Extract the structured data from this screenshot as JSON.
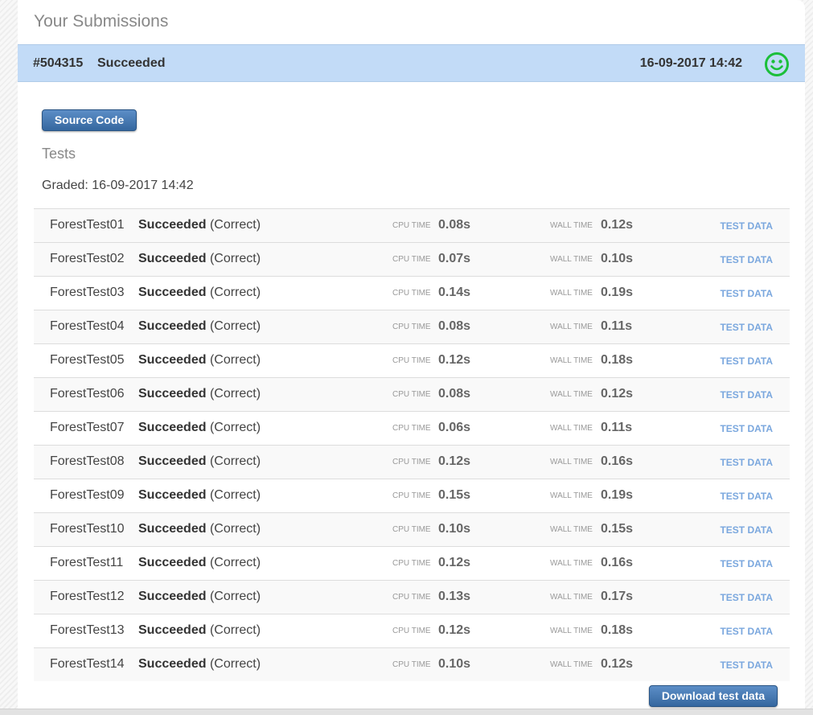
{
  "panel": {
    "title": "Your Submissions"
  },
  "submission": {
    "id": "#504315",
    "status": "Succeeded",
    "date": "16-09-2017 14:42",
    "status_icon": "smiley-icon",
    "status_color": "#1bbf3a",
    "header_bg": "#c2dbf7"
  },
  "details": {
    "source_button_label": "Source Code",
    "tests_heading": "Tests",
    "graded_text": "Graded: 16-09-2017 14:42",
    "cpu_label": "CPU TIME",
    "wall_label": "WALL TIME",
    "test_data_label": "TEST DATA",
    "download_button_label": "Download test data"
  },
  "tests": [
    {
      "name": "ForestTest01",
      "status": "Succeeded",
      "verdict": "(Correct)",
      "cpu": "0.08s",
      "wall": "0.12s"
    },
    {
      "name": "ForestTest02",
      "status": "Succeeded",
      "verdict": "(Correct)",
      "cpu": "0.07s",
      "wall": "0.10s"
    },
    {
      "name": "ForestTest03",
      "status": "Succeeded",
      "verdict": "(Correct)",
      "cpu": "0.14s",
      "wall": "0.19s"
    },
    {
      "name": "ForestTest04",
      "status": "Succeeded",
      "verdict": "(Correct)",
      "cpu": "0.08s",
      "wall": "0.11s"
    },
    {
      "name": "ForestTest05",
      "status": "Succeeded",
      "verdict": "(Correct)",
      "cpu": "0.12s",
      "wall": "0.18s"
    },
    {
      "name": "ForestTest06",
      "status": "Succeeded",
      "verdict": "(Correct)",
      "cpu": "0.08s",
      "wall": "0.12s"
    },
    {
      "name": "ForestTest07",
      "status": "Succeeded",
      "verdict": "(Correct)",
      "cpu": "0.06s",
      "wall": "0.11s"
    },
    {
      "name": "ForestTest08",
      "status": "Succeeded",
      "verdict": "(Correct)",
      "cpu": "0.12s",
      "wall": "0.16s"
    },
    {
      "name": "ForestTest09",
      "status": "Succeeded",
      "verdict": "(Correct)",
      "cpu": "0.15s",
      "wall": "0.19s"
    },
    {
      "name": "ForestTest10",
      "status": "Succeeded",
      "verdict": "(Correct)",
      "cpu": "0.10s",
      "wall": "0.15s"
    },
    {
      "name": "ForestTest11",
      "status": "Succeeded",
      "verdict": "(Correct)",
      "cpu": "0.12s",
      "wall": "0.16s"
    },
    {
      "name": "ForestTest12",
      "status": "Succeeded",
      "verdict": "(Correct)",
      "cpu": "0.13s",
      "wall": "0.17s"
    },
    {
      "name": "ForestTest13",
      "status": "Succeeded",
      "verdict": "(Correct)",
      "cpu": "0.12s",
      "wall": "0.18s"
    },
    {
      "name": "ForestTest14",
      "status": "Succeeded",
      "verdict": "(Correct)",
      "cpu": "0.10s",
      "wall": "0.12s"
    }
  ]
}
